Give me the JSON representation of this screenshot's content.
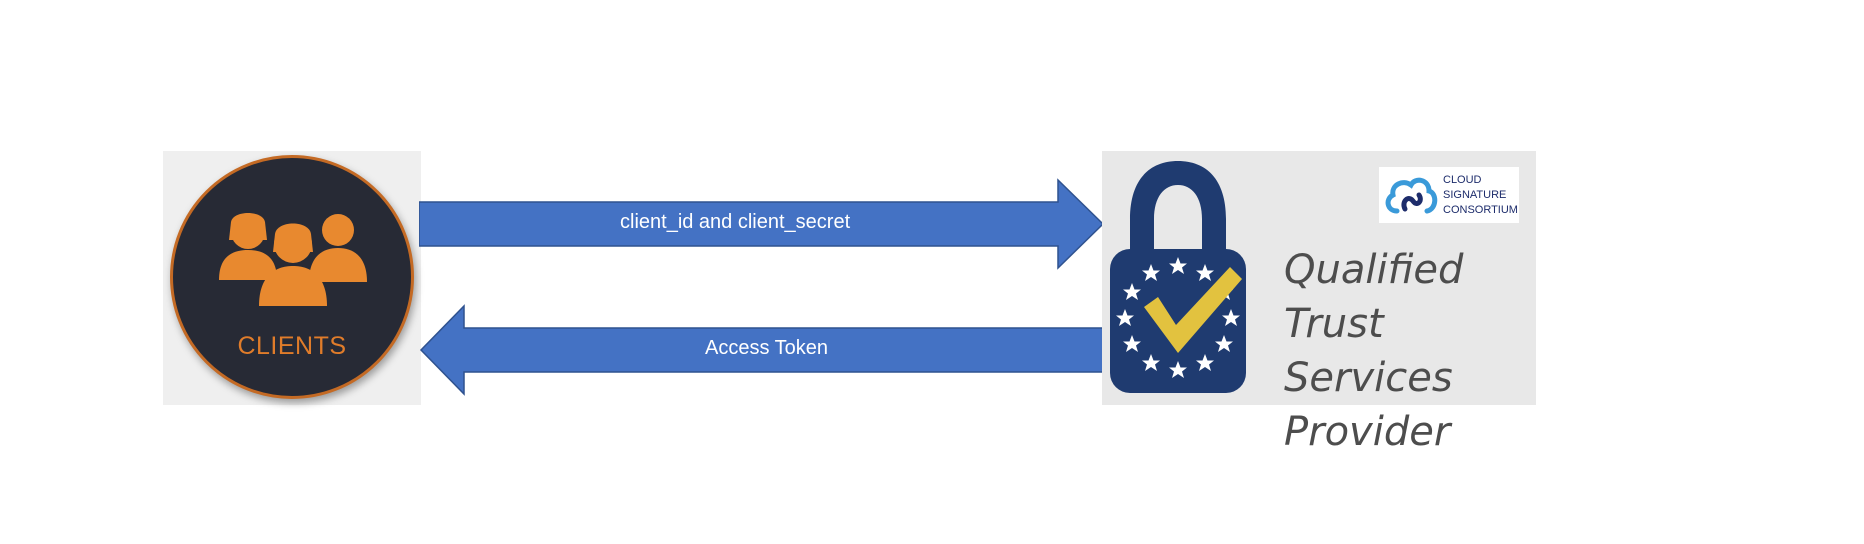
{
  "clients": {
    "label": "CLIENTS",
    "icon": "people-group-icon"
  },
  "arrows": {
    "request_label": "client_id and client_secret",
    "response_label": "Access Token",
    "color": "#4472c4"
  },
  "provider": {
    "title_line1": "Qualified",
    "title_line2": "Trust Services",
    "title_line3": "Provider",
    "icon": "eu-trust-lock-icon",
    "badge": {
      "line1": "CLOUD",
      "line2": "SIGNATURE",
      "line3": "CONSORTIUM",
      "icon": "cloud-signature-logo-icon"
    }
  },
  "colors": {
    "clients_orange": "#e07c2a",
    "clients_dark": "#272a35",
    "lock_navy": "#1f3b70",
    "check_gold": "#e2c23f",
    "logo_blue": "#3a9ad9"
  }
}
